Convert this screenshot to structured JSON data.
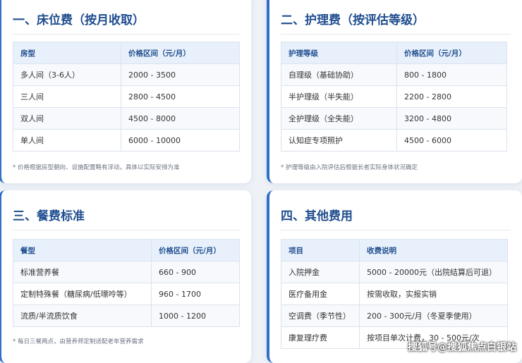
{
  "bed_fee": {
    "title": "一、床位费（按月收取）",
    "headers": [
      "房型",
      "价格区间（元/月）"
    ],
    "rows": [
      [
        "多人间（3-6人）",
        "2000 - 3500"
      ],
      [
        "三人间",
        "2800 - 4500"
      ],
      [
        "双人间",
        "4500 - 8000"
      ],
      [
        "单人间",
        "6000 - 10000"
      ]
    ],
    "note": "* 价格根据房型朝向、设施配置略有浮动，具体以实际安排为准"
  },
  "care_fee": {
    "title": "二、护理费（按评估等级）",
    "headers": [
      "护理等级",
      "价格区间（元/月）"
    ],
    "rows": [
      [
        "自理级（基础协助）",
        "800 - 1800"
      ],
      [
        "半护理级（半失能）",
        "2200 - 2800"
      ],
      [
        "全护理级（全失能）",
        "3200 - 4800"
      ],
      [
        "认知症专项照护",
        "4500 - 6000"
      ]
    ],
    "note": "* 护理等级由入院评估后根据长者实际身体状况确定"
  },
  "meal_fee": {
    "title": "三、餐费标准",
    "headers": [
      "餐型",
      "价格区间（元/月）"
    ],
    "rows": [
      [
        "标准营养餐",
        "660 - 900"
      ],
      [
        "定制特殊餐（糖尿病/低嘌呤等）",
        "960 - 1700"
      ],
      [
        "流质/半流质饮食",
        "1000 - 1200"
      ]
    ],
    "note": "* 每日三餐两点，由营养师定制适配老年营养需求"
  },
  "other_fee": {
    "title": "四、其他费用",
    "headers": [
      "项目",
      "收费说明"
    ],
    "rows": [
      [
        "入院押金",
        "5000 - 20000元（出院结算后可退）"
      ],
      [
        "医疗备用金",
        "按需收取，实报实销"
      ],
      [
        "空调费（季节性）",
        "200 - 300元/月（冬夏季使用）"
      ],
      [
        "康复理疗费",
        "按项目单次计费，30 - 500元/次"
      ]
    ]
  },
  "watermark": "搜狐号@搜狐焦点白银站"
}
